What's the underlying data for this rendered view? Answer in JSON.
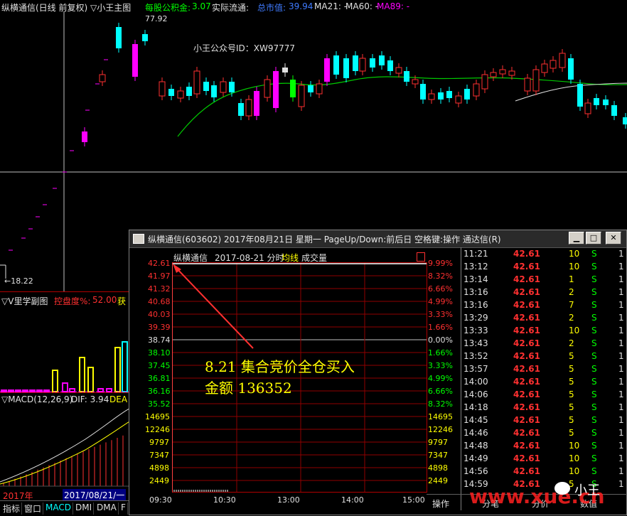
{
  "main_panel": {
    "title": "纵横通信(日线 前复权) ▽小王主图",
    "funds_label": "每股公积金:",
    "funds_value": "3.07",
    "float_label": "实际流通:",
    "float_value": "",
    "mktcap_label": "总市值:",
    "mktcap_value": "39.94",
    "ma21": "MA21: -",
    "ma60": "MA60: -",
    "ma89": "MA89: -",
    "high_marker": "77.92",
    "low_marker": "←18.22",
    "watermark_text": "小王公众号ID：XW97777"
  },
  "vol_panel": {
    "title": "▽V里学副图",
    "label": "控盘度%:",
    "value": "52.00",
    "extra": "获"
  },
  "macd_panel": {
    "title": "▽MACD(12,26,9)",
    "dif": "DIF: 3.94",
    "dea": "DEA"
  },
  "date_axis": {
    "year": "2017年",
    "cursor_date": "2017/08/21/一"
  },
  "bottom_tabs": [
    "指标",
    "窗口",
    "MACD",
    "DMI",
    "DMA",
    "F"
  ],
  "popup": {
    "title": "纵横通信(603602) 2017年08月21日 星期一 PageUp/Down:前后日 空格键:操作 通达信(R)",
    "header_name": "纵横通信",
    "header_date": "2017-08-21 分时",
    "header_avg": "均线",
    "header_vol": "成交量",
    "price_labels": [
      "42.61",
      "41.97",
      "41.32",
      "40.68",
      "40.03",
      "39.39",
      "38.74",
      "38.10",
      "37.45",
      "36.81",
      "36.16",
      "35.52"
    ],
    "pct_labels": [
      "9.99%",
      "8.32%",
      "6.66%",
      "4.99%",
      "3.33%",
      "1.66%",
      "0.00%",
      "1.66%",
      "3.33%",
      "4.99%",
      "6.66%",
      "8.32%"
    ],
    "vol_labels": [
      "14695",
      "12246",
      "9797",
      "7347",
      "4898",
      "2449"
    ],
    "time_labels": [
      "09:30",
      "10:30",
      "13:00",
      "14:00",
      "15:00"
    ],
    "annotation_line1": "8.21 集合竞价全仓买入",
    "annotation_line2": "金额 136352",
    "ticks": [
      {
        "time": "11:21",
        "price": "42.61",
        "vol": "10",
        "side": "S",
        "n": "1"
      },
      {
        "time": "13:12",
        "price": "42.61",
        "vol": "10",
        "side": "S",
        "n": "1"
      },
      {
        "time": "13:14",
        "price": "42.61",
        "vol": "1",
        "side": "S",
        "n": "1"
      },
      {
        "time": "13:16",
        "price": "42.61",
        "vol": "2",
        "side": "S",
        "n": "1"
      },
      {
        "time": "13:16",
        "price": "42.61",
        "vol": "7",
        "side": "S",
        "n": "1"
      },
      {
        "time": "13:29",
        "price": "42.61",
        "vol": "2",
        "side": "S",
        "n": "1"
      },
      {
        "time": "13:33",
        "price": "42.61",
        "vol": "10",
        "side": "S",
        "n": "1"
      },
      {
        "time": "13:43",
        "price": "42.61",
        "vol": "2",
        "side": "S",
        "n": "1"
      },
      {
        "time": "13:52",
        "price": "42.61",
        "vol": "5",
        "side": "S",
        "n": "1"
      },
      {
        "time": "13:57",
        "price": "42.61",
        "vol": "5",
        "side": "S",
        "n": "1"
      },
      {
        "time": "14:00",
        "price": "42.61",
        "vol": "5",
        "side": "S",
        "n": "1"
      },
      {
        "time": "14:06",
        "price": "42.61",
        "vol": "5",
        "side": "S",
        "n": "1"
      },
      {
        "time": "14:18",
        "price": "42.61",
        "vol": "5",
        "side": "S",
        "n": "1"
      },
      {
        "time": "14:45",
        "price": "42.61",
        "vol": "5",
        "side": "S",
        "n": "1"
      },
      {
        "time": "14:46",
        "price": "42.61",
        "vol": "5",
        "side": "S",
        "n": "1"
      },
      {
        "time": "14:48",
        "price": "42.61",
        "vol": "10",
        "side": "S",
        "n": "1"
      },
      {
        "time": "14:49",
        "price": "42.61",
        "vol": "10",
        "side": "S",
        "n": "1"
      },
      {
        "time": "14:56",
        "price": "42.61",
        "vol": "10",
        "side": "S",
        "n": "1"
      },
      {
        "time": "14:59",
        "price": "42.61",
        "vol": "5",
        "side": "S",
        "n": "1"
      }
    ],
    "bottom_labels": [
      "操作",
      "分笔",
      "分价",
      "数值"
    ]
  },
  "watermark_site": "www.xue.cn",
  "watermark_name": "小王",
  "colors": {
    "up": "#ff3030",
    "down": "#00ffff",
    "ma": "#00c800",
    "limit": "#ff00ff"
  }
}
